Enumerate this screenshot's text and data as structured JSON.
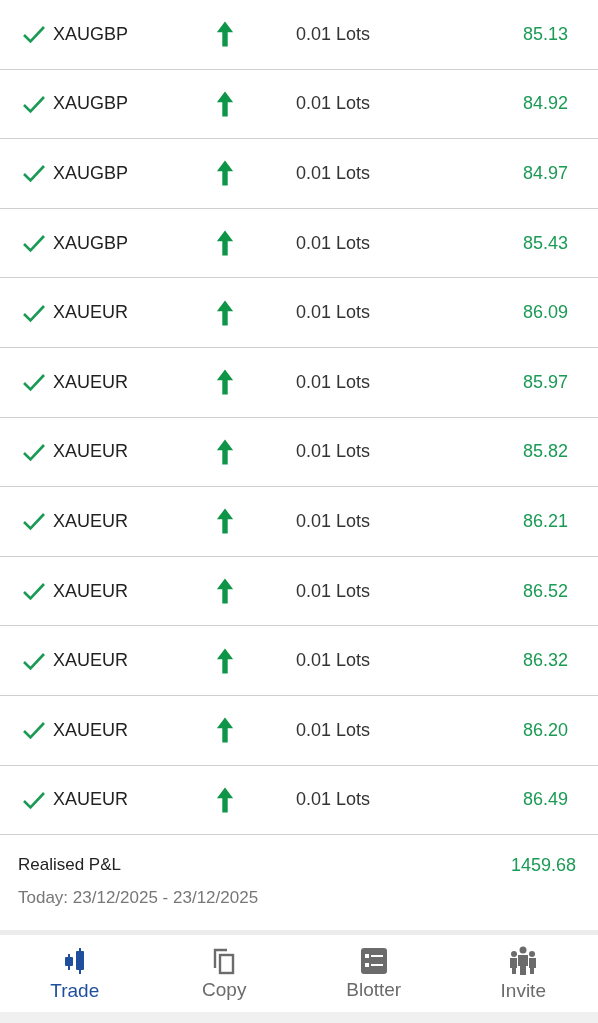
{
  "trades": [
    {
      "symbol": "XAUGBP",
      "up": true,
      "volume": "0.01 Lots",
      "profit": "85.13"
    },
    {
      "symbol": "XAUGBP",
      "up": true,
      "volume": "0.01 Lots",
      "profit": "84.92"
    },
    {
      "symbol": "XAUGBP",
      "up": true,
      "volume": "0.01 Lots",
      "profit": "84.97"
    },
    {
      "symbol": "XAUGBP",
      "up": true,
      "volume": "0.01 Lots",
      "profit": "85.43"
    },
    {
      "symbol": "XAUEUR",
      "up": true,
      "volume": "0.01 Lots",
      "profit": "86.09"
    },
    {
      "symbol": "XAUEUR",
      "up": true,
      "volume": "0.01 Lots",
      "profit": "85.97"
    },
    {
      "symbol": "XAUEUR",
      "up": true,
      "volume": "0.01 Lots",
      "profit": "85.82"
    },
    {
      "symbol": "XAUEUR",
      "up": true,
      "volume": "0.01 Lots",
      "profit": "86.21"
    },
    {
      "symbol": "XAUEUR",
      "up": true,
      "volume": "0.01 Lots",
      "profit": "86.52"
    },
    {
      "symbol": "XAUEUR",
      "up": true,
      "volume": "0.01 Lots",
      "profit": "86.32"
    },
    {
      "symbol": "XAUEUR",
      "up": true,
      "volume": "0.01 Lots",
      "profit": "86.20"
    },
    {
      "symbol": "XAUEUR",
      "up": true,
      "volume": "0.01 Lots",
      "profit": "86.49"
    }
  ],
  "summary": {
    "label": "Realised P&L",
    "value": "1459.68",
    "period": "Today: 23/12/2025 - 23/12/2025"
  },
  "nav": [
    {
      "kind": "trade",
      "label": "Trade",
      "selected": true
    },
    {
      "kind": "copy",
      "label": "Copy",
      "selected": false
    },
    {
      "kind": "blotter",
      "label": "Blotter",
      "selected": false
    },
    {
      "kind": "invite",
      "label": "Invite",
      "selected": false
    }
  ]
}
